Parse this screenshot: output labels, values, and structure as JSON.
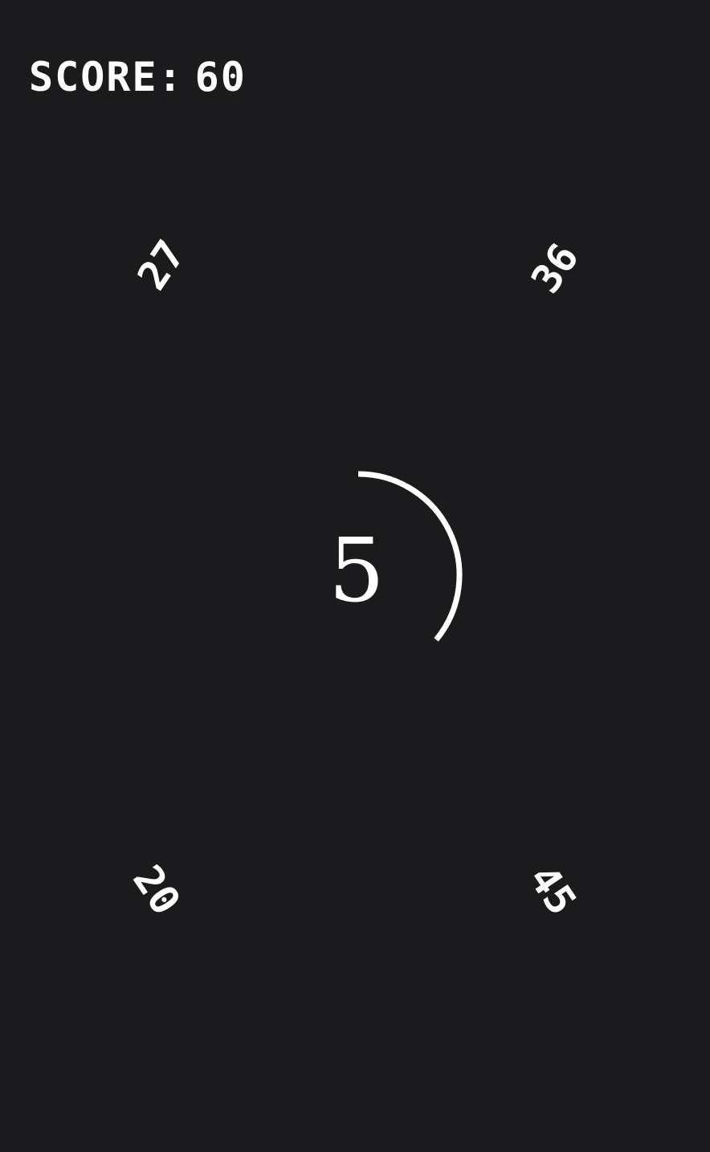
{
  "hud": {
    "score_label": "SCORE:",
    "score_value": "60"
  },
  "tiles": {
    "top_left": "27",
    "top_right": "36",
    "bottom_left": "20",
    "bottom_right": "45"
  },
  "timer": {
    "countdown": "5",
    "remaining_fraction": 0.36,
    "ring_color": "#ffffff"
  },
  "colors": {
    "background": "#1b1b1d",
    "foreground": "#ffffff"
  }
}
